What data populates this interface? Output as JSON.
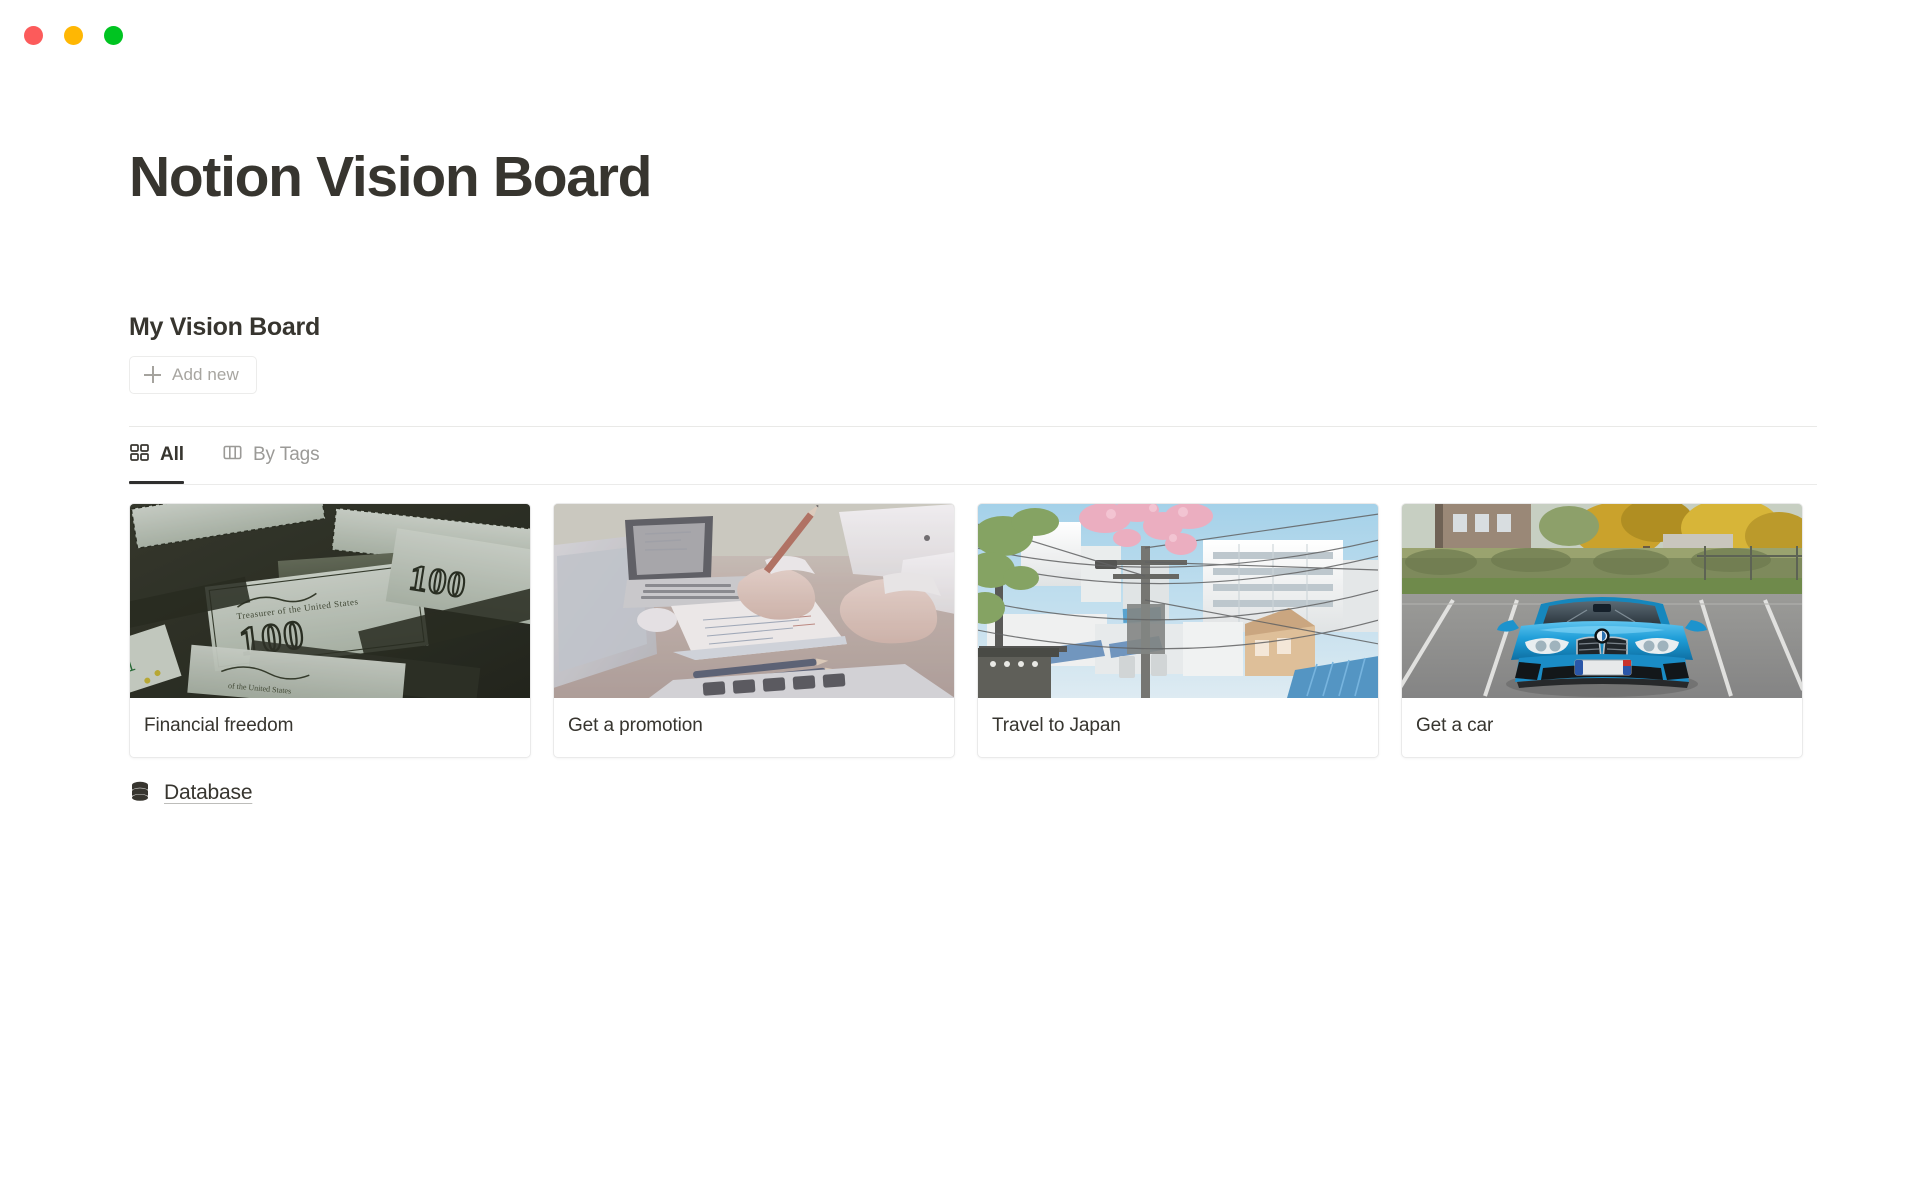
{
  "window": {
    "traffic_lights": [
      {
        "name": "close-button",
        "color": "#fc5b5b"
      },
      {
        "name": "minimize-button",
        "color": "#ffb703"
      },
      {
        "name": "maximize-button",
        "color": "#00c421"
      }
    ]
  },
  "page": {
    "title": "Notion Vision Board",
    "section_title": "My Vision Board",
    "text_color": "#37352f"
  },
  "toolbar": {
    "add_new_label": "Add new",
    "add_new_icon": "plus-icon"
  },
  "tabs": [
    {
      "label": "All",
      "icon": "gallery-grid-icon",
      "active": true
    },
    {
      "label": "By Tags",
      "icon": "board-columns-icon",
      "active": false
    }
  ],
  "gallery": {
    "cards": [
      {
        "title": "Financial freedom",
        "image_alt": "scattered one hundred dollar bills in dark lighting",
        "palette": {
          "bg": "#2f3126",
          "paper": "#dfe6dd",
          "ink": "#1d2018",
          "accent": "#4c5140"
        }
      },
      {
        "title": "Get a promotion",
        "image_alt": "hands writing in a notebook beside laptops on a wooden desk",
        "palette": {
          "bg": "#c8bfbb",
          "paper": "#f2eeeb",
          "ink": "#6b5e57",
          "accent": "#9f9087"
        }
      },
      {
        "title": "Travel to Japan",
        "image_alt": "Japanese residential street with cherry blossoms, power lines and white buildings",
        "palette": {
          "bg": "#b9d8ea",
          "paper": "#f4f4f2",
          "ink": "#6e7a80",
          "accent": "#e6a8bd"
        }
      },
      {
        "title": "Get a car",
        "image_alt": "blue BMW coupe parked in an empty parking lot with autumn trees",
        "palette": {
          "bg": "#8e9687",
          "paper": "#9a9a97",
          "ink": "#2b2f33",
          "accent": "#1f9bd8"
        }
      }
    ]
  },
  "footer": {
    "database_label": "Database",
    "database_icon": "database-icon"
  }
}
